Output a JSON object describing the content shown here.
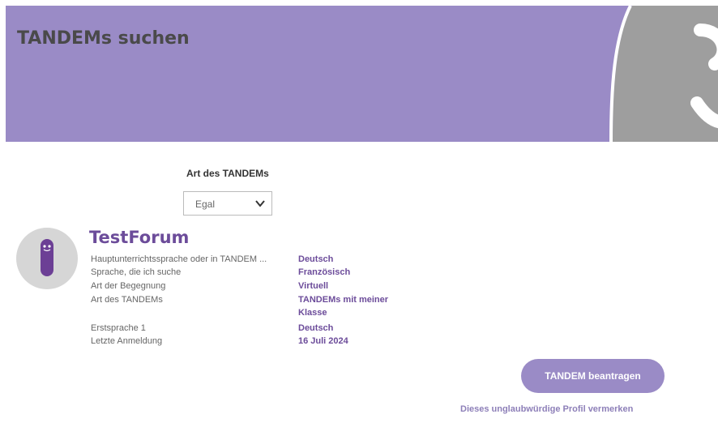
{
  "header": {
    "title": "TANDEMs suchen"
  },
  "filter": {
    "label": "Art des TANDEMs",
    "selected": "Egal"
  },
  "profile": {
    "name": "TestForum",
    "rows": [
      {
        "label": "Hauptunterrichtssprache oder in TANDEM ...",
        "value": "Deutsch"
      },
      {
        "label": "Sprache, die ich suche",
        "value": "Französisch"
      },
      {
        "label": "Art der Begegnung",
        "value": "Virtuell"
      },
      {
        "label": "Art des TANDEMs",
        "value": "TANDEMs mit meiner Klasse"
      },
      {
        "label": "Erstsprache 1",
        "value": "Deutsch"
      },
      {
        "label": "Letzte Anmeldung",
        "value": "16 Juli 2024"
      }
    ]
  },
  "actions": {
    "request_button": "TANDEM beantragen",
    "report_link": "Dieses unglaubwürdige Profil vermerken"
  },
  "colors": {
    "banner": "#9a8bc6",
    "accent": "#6c4c9a"
  }
}
